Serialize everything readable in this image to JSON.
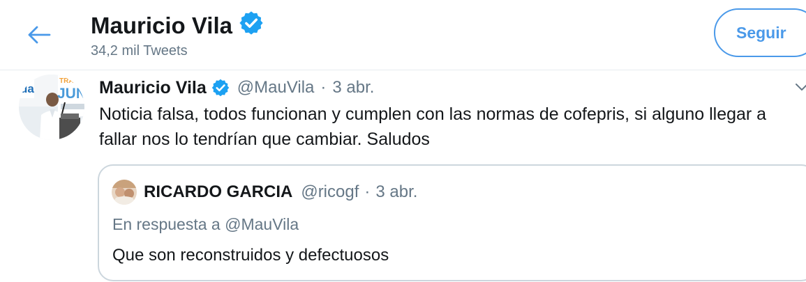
{
  "header": {
    "title": "Mauricio Vila",
    "tweet_count": "34,2 mil Tweets",
    "follow_label": "Seguir"
  },
  "tweet": {
    "author_name": "Mauricio Vila",
    "author_handle": "@MauVila",
    "separator": "·",
    "date": "3 abr.",
    "text": "Noticia falsa, todos funcionan y cumplen con las normas de cofepris, si alguno llegar a fallar nos lo tendrían que cambiar. Saludos",
    "avatar_banner_text": [
      "da",
      "TRA",
      "JUN"
    ]
  },
  "quote": {
    "author_name": "RICARDO GARCIA",
    "author_handle": "@ricogf",
    "separator": "·",
    "date": "3 abr.",
    "reply_prefix": "En respuesta a",
    "reply_to": "@MauVila",
    "text": "Que son reconstruidos y defectuosos"
  },
  "icons": {
    "back": "arrow-left-icon",
    "verified": "verified-badge-icon",
    "caret": "chevron-down-icon"
  },
  "colors": {
    "accent": "#4a99e9",
    "text_primary": "#14171a",
    "text_secondary": "#657786",
    "border": "#ccd6dd",
    "divider": "#e6ecf0",
    "verified": "#1da1f2"
  }
}
